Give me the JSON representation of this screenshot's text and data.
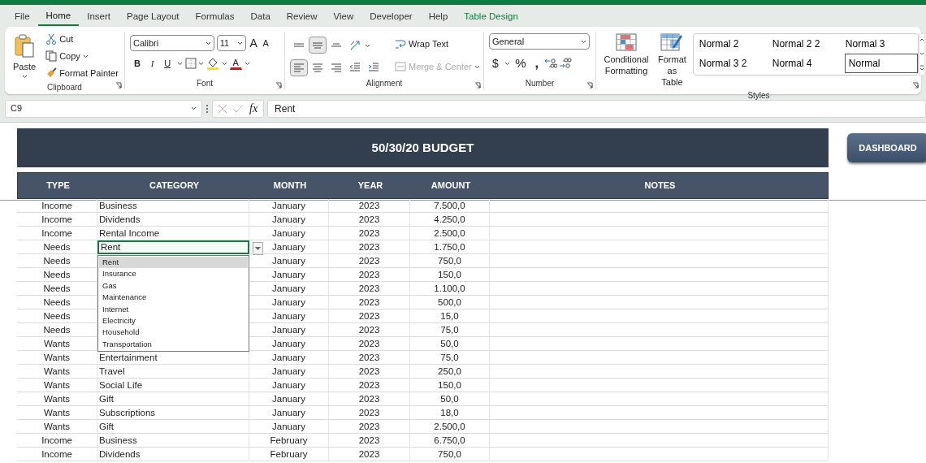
{
  "menu_tabs": [
    {
      "label": "File",
      "selected": false,
      "kind": "normal"
    },
    {
      "label": "Home",
      "selected": true,
      "kind": "normal"
    },
    {
      "label": "Insert",
      "selected": false,
      "kind": "normal"
    },
    {
      "label": "Page Layout",
      "selected": false,
      "kind": "normal"
    },
    {
      "label": "Formulas",
      "selected": false,
      "kind": "normal"
    },
    {
      "label": "Data",
      "selected": false,
      "kind": "normal"
    },
    {
      "label": "Review",
      "selected": false,
      "kind": "normal"
    },
    {
      "label": "View",
      "selected": false,
      "kind": "normal"
    },
    {
      "label": "Developer",
      "selected": false,
      "kind": "normal"
    },
    {
      "label": "Help",
      "selected": false,
      "kind": "normal"
    },
    {
      "label": "Table Design",
      "selected": false,
      "kind": "contextual"
    }
  ],
  "ribbon": {
    "clipboard": {
      "label": "Clipboard",
      "paste": "Paste",
      "cut": "Cut",
      "copy": "Copy",
      "format_painter": "Format Painter"
    },
    "font": {
      "label": "Font",
      "font_name": "Calibri",
      "font_size": "11",
      "grow": "A",
      "shrink": "A",
      "buttons": [
        {
          "label": "B",
          "kind": "bold"
        },
        {
          "label": "I",
          "kind": "italic"
        },
        {
          "label": "U",
          "kind": "underline"
        }
      ],
      "font_color": "A"
    },
    "alignment": {
      "label": "Alignment",
      "wrap_text": "Wrap Text",
      "merge_center": "Merge & Center",
      "merge_disabled": true,
      "buttons": [
        {
          "kind": "top",
          "pressed": false
        },
        {
          "kind": "middle",
          "pressed": true
        },
        {
          "kind": "bottom",
          "pressed": false
        },
        {
          "kind": "orientation",
          "pressed": false
        },
        {
          "kind": "left",
          "pressed": true
        },
        {
          "kind": "center",
          "pressed": false
        },
        {
          "kind": "right",
          "pressed": false
        },
        {
          "kind": "outdent",
          "pressed": false
        },
        {
          "kind": "indent",
          "pressed": false
        }
      ]
    },
    "number": {
      "label": "Number",
      "format": "General",
      "currency": "$",
      "percent": "%",
      "comma": ","
    },
    "styles": {
      "label": "Styles",
      "conditional": "Conditional Formatting",
      "format_table": "Format as Table",
      "gallery": [
        {
          "label": "Normal 2",
          "selected": false
        },
        {
          "label": "Normal 2 2",
          "selected": false
        },
        {
          "label": "Normal 3",
          "selected": false
        },
        {
          "label": "Normal 3 2",
          "selected": false
        },
        {
          "label": "Normal 4",
          "selected": false
        },
        {
          "label": "Normal",
          "selected": true
        }
      ]
    }
  },
  "formula_bar": {
    "name_box": "C9",
    "fx": "fx",
    "value": "Rent"
  },
  "sheet": {
    "title": "50/30/20 BUDGET",
    "dashboard_button": "DASHBOARD",
    "columns": [
      "TYPE",
      "CATEGORY",
      "MONTH",
      "YEAR",
      "AMOUNT",
      "NOTES"
    ],
    "rows": [
      {
        "type": "Income",
        "category": "Business",
        "month": "January",
        "year": "2023",
        "amount": "7.500,0",
        "selected": false
      },
      {
        "type": "Income",
        "category": "Dividends",
        "month": "January",
        "year": "2023",
        "amount": "4.250,0",
        "selected": false
      },
      {
        "type": "Income",
        "category": "Rental Income",
        "month": "January",
        "year": "2023",
        "amount": "2.500,0",
        "selected": false
      },
      {
        "type": "Needs",
        "category": "Rent",
        "month": "January",
        "year": "2023",
        "amount": "1.750,0",
        "selected": true
      },
      {
        "type": "Needs",
        "month": "January",
        "year": "2023",
        "amount": "750,0",
        "selected": false
      },
      {
        "type": "Needs",
        "month": "January",
        "year": "2023",
        "amount": "150,0",
        "selected": false
      },
      {
        "type": "Needs",
        "month": "January",
        "year": "2023",
        "amount": "1.100,0",
        "selected": false
      },
      {
        "type": "Needs",
        "month": "January",
        "year": "2023",
        "amount": "500,0",
        "selected": false
      },
      {
        "type": "Needs",
        "month": "January",
        "year": "2023",
        "amount": "15,0",
        "selected": false
      },
      {
        "type": "Needs",
        "month": "January",
        "year": "2023",
        "amount": "75,0",
        "selected": false
      },
      {
        "type": "Wants",
        "month": "January",
        "year": "2023",
        "amount": "50,0",
        "selected": false
      },
      {
        "type": "Wants",
        "category": "Entertainment",
        "month": "January",
        "year": "2023",
        "amount": "75,0",
        "selected": false
      },
      {
        "type": "Wants",
        "category": "Travel",
        "month": "January",
        "year": "2023",
        "amount": "250,0",
        "selected": false
      },
      {
        "type": "Wants",
        "category": "Social Life",
        "month": "January",
        "year": "2023",
        "amount": "150,0",
        "selected": false
      },
      {
        "type": "Wants",
        "category": "Gift",
        "month": "January",
        "year": "2023",
        "amount": "50,0",
        "selected": false
      },
      {
        "type": "Wants",
        "category": "Subscriptions",
        "month": "January",
        "year": "2023",
        "amount": "18,0",
        "selected": false
      },
      {
        "type": "Wants",
        "category": "Gift",
        "month": "January",
        "year": "2023",
        "amount": "2.500,0",
        "selected": false
      },
      {
        "type": "Income",
        "category": "Business",
        "month": "February",
        "year": "2023",
        "amount": "6.750,0",
        "selected": false
      },
      {
        "type": "Income",
        "category": "Dividends",
        "month": "February",
        "year": "2023",
        "amount": "750,0",
        "selected": false
      }
    ],
    "dropdown": [
      {
        "label": "Rent",
        "selected": true
      },
      {
        "label": "Insurance",
        "selected": false
      },
      {
        "label": "Gas",
        "selected": false
      },
      {
        "label": "Maintenance",
        "selected": false
      },
      {
        "label": "Internet",
        "selected": false
      },
      {
        "label": "Electricity",
        "selected": false
      },
      {
        "label": "Household",
        "selected": false
      },
      {
        "label": "Transportation",
        "selected": false
      }
    ]
  }
}
